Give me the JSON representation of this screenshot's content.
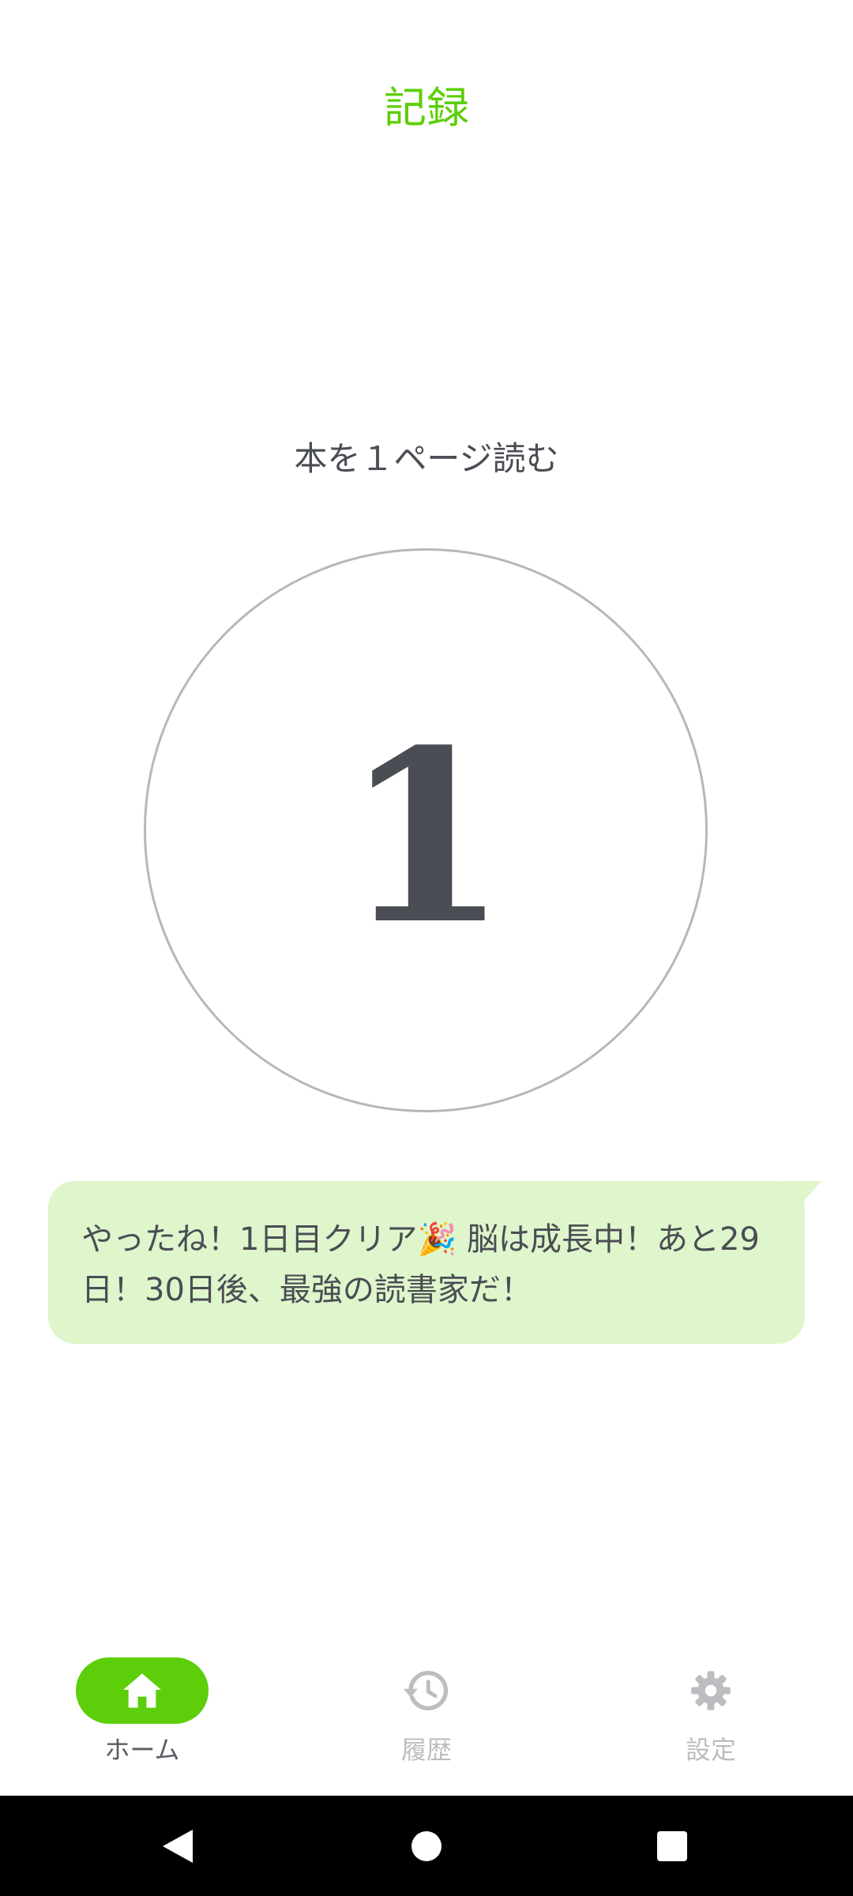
{
  "header": {
    "title": "記録"
  },
  "task": {
    "label": "本を１ページ読む"
  },
  "counter": {
    "value": "1"
  },
  "message": {
    "text": "やったね！1日目クリア🎉 脳は成長中！あと29日！30日後、最強の読書家だ！"
  },
  "bottom_nav": {
    "items": [
      {
        "label": "ホーム",
        "icon": "home-icon",
        "active": true
      },
      {
        "label": "履歴",
        "icon": "history-icon",
        "active": false
      },
      {
        "label": "設定",
        "icon": "gear-icon",
        "active": false
      }
    ]
  },
  "system_nav": {
    "buttons": [
      "back",
      "home",
      "recents"
    ]
  },
  "colors": {
    "accent": "#5ccf0a",
    "text": "#4a4d53",
    "bubble": "#dff5cc",
    "inactive": "#bdbdc1"
  }
}
